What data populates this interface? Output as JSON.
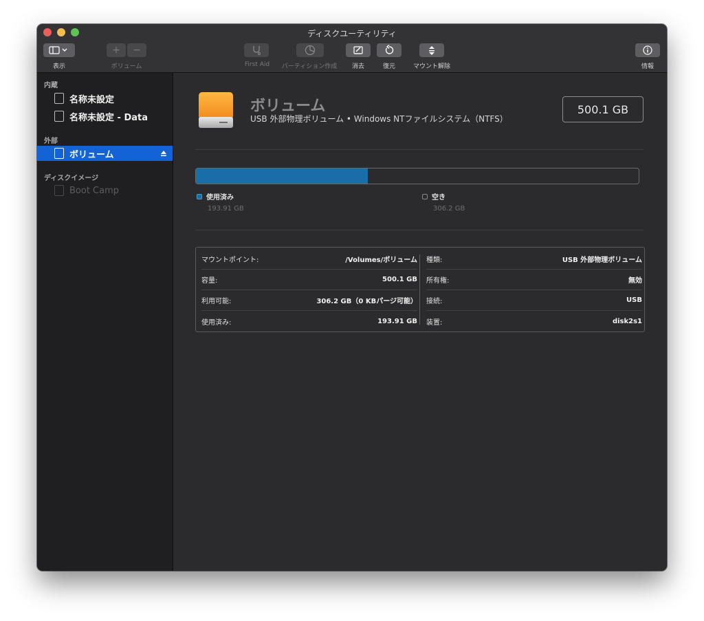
{
  "window": {
    "title": "ディスクユーティリティ"
  },
  "toolbar": {
    "view_label": "表示",
    "volume_label": "ボリューム",
    "firstaid_label": "First Aid",
    "partition_label": "パーティション作成",
    "erase_label": "消去",
    "restore_label": "復元",
    "unmount_label": "マウント解除",
    "info_label": "情報",
    "add_glyph": "+",
    "remove_glyph": "−"
  },
  "sidebar": {
    "internal_header": "内蔵",
    "internal_items": [
      "名称未設定",
      "名称未設定 - Data"
    ],
    "external_header": "外部",
    "external_items": [
      "ボリューム"
    ],
    "images_header": "ディスクイメージ",
    "image_items": [
      "Boot Camp"
    ]
  },
  "volume": {
    "name": "ボリューム",
    "subtitle": "USB 外部物理ボリューム • Windows NTファイルシステム（NTFS）",
    "capacity": "500.1 GB"
  },
  "usage": {
    "used_label": "使用済み",
    "used_value": "193.91 GB",
    "free_label": "空き",
    "free_value": "306.2 GB",
    "used_fraction": 0.3877
  },
  "details": {
    "left": [
      {
        "key": "マウントポイント:",
        "value": "/Volumes/ボリューム"
      },
      {
        "key": "容量:",
        "value": "500.1 GB"
      },
      {
        "key": "利用可能:",
        "value": "306.2 GB（0 KBパージ可能）"
      },
      {
        "key": "使用済み:",
        "value": "193.91 GB"
      }
    ],
    "right": [
      {
        "key": "種類:",
        "value": "USB 外部物理ボリューム"
      },
      {
        "key": "所有権:",
        "value": "無効"
      },
      {
        "key": "接続:",
        "value": "USB"
      },
      {
        "key": "装置:",
        "value": "disk2s1"
      }
    ]
  },
  "colors": {
    "accent": "#1463d6",
    "used_bar": "#1a6ea8",
    "sidebar_bg": "#1f1f21",
    "main_bg": "#2b2b2e"
  }
}
